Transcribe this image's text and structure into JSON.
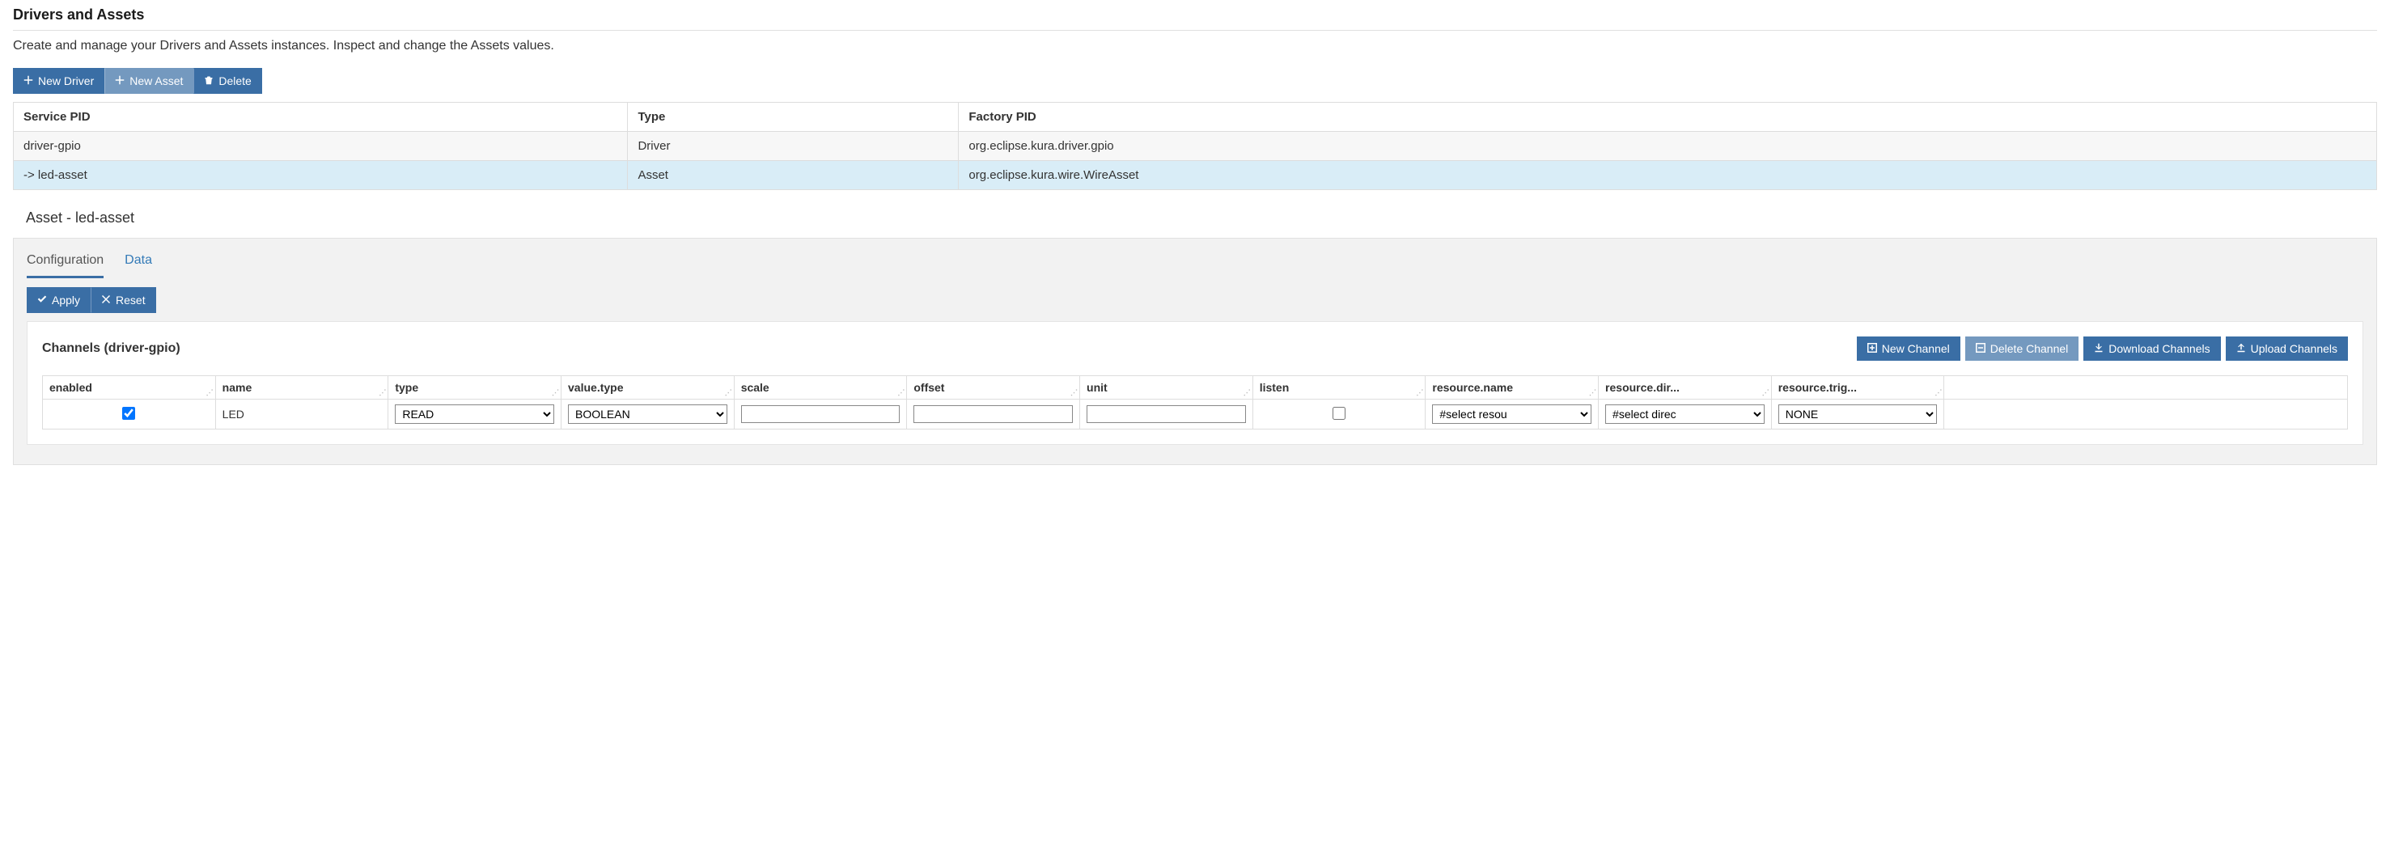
{
  "header": {
    "title": "Drivers and Assets",
    "subtitle": "Create and manage your Drivers and Assets instances. Inspect and change the Assets values."
  },
  "toolbar": {
    "new_driver": "New Driver",
    "new_asset": "New Asset",
    "delete": "Delete"
  },
  "drivers_table": {
    "headers": {
      "service_pid": "Service PID",
      "type": "Type",
      "factory_pid": "Factory PID"
    },
    "rows": [
      {
        "service_pid": "driver-gpio",
        "type": "Driver",
        "factory_pid": "org.eclipse.kura.driver.gpio",
        "selected": false
      },
      {
        "service_pid": "-> led-asset",
        "type": "Asset",
        "factory_pid": "org.eclipse.kura.wire.WireAsset",
        "selected": true
      }
    ]
  },
  "asset_panel": {
    "title": "Asset - led-asset",
    "tabs": {
      "configuration": "Configuration",
      "data": "Data"
    },
    "apply": "Apply",
    "reset": "Reset"
  },
  "channels": {
    "title": "Channels (driver-gpio)",
    "buttons": {
      "new_channel": "New Channel",
      "delete_channel": "Delete Channel",
      "download_channels": "Download Channels",
      "upload_channels": "Upload Channels"
    },
    "headers": [
      "enabled",
      "name",
      "type",
      "value.type",
      "scale",
      "offset",
      "unit",
      "listen",
      "resource.name",
      "resource.dir...",
      "resource.trig..."
    ],
    "row": {
      "enabled": true,
      "name": "LED",
      "type": "READ",
      "value_type": "BOOLEAN",
      "scale": "",
      "offset": "",
      "unit": "",
      "listen": false,
      "resource_name": "#select resou",
      "resource_dir": "#select direc",
      "resource_trig": "NONE"
    }
  }
}
